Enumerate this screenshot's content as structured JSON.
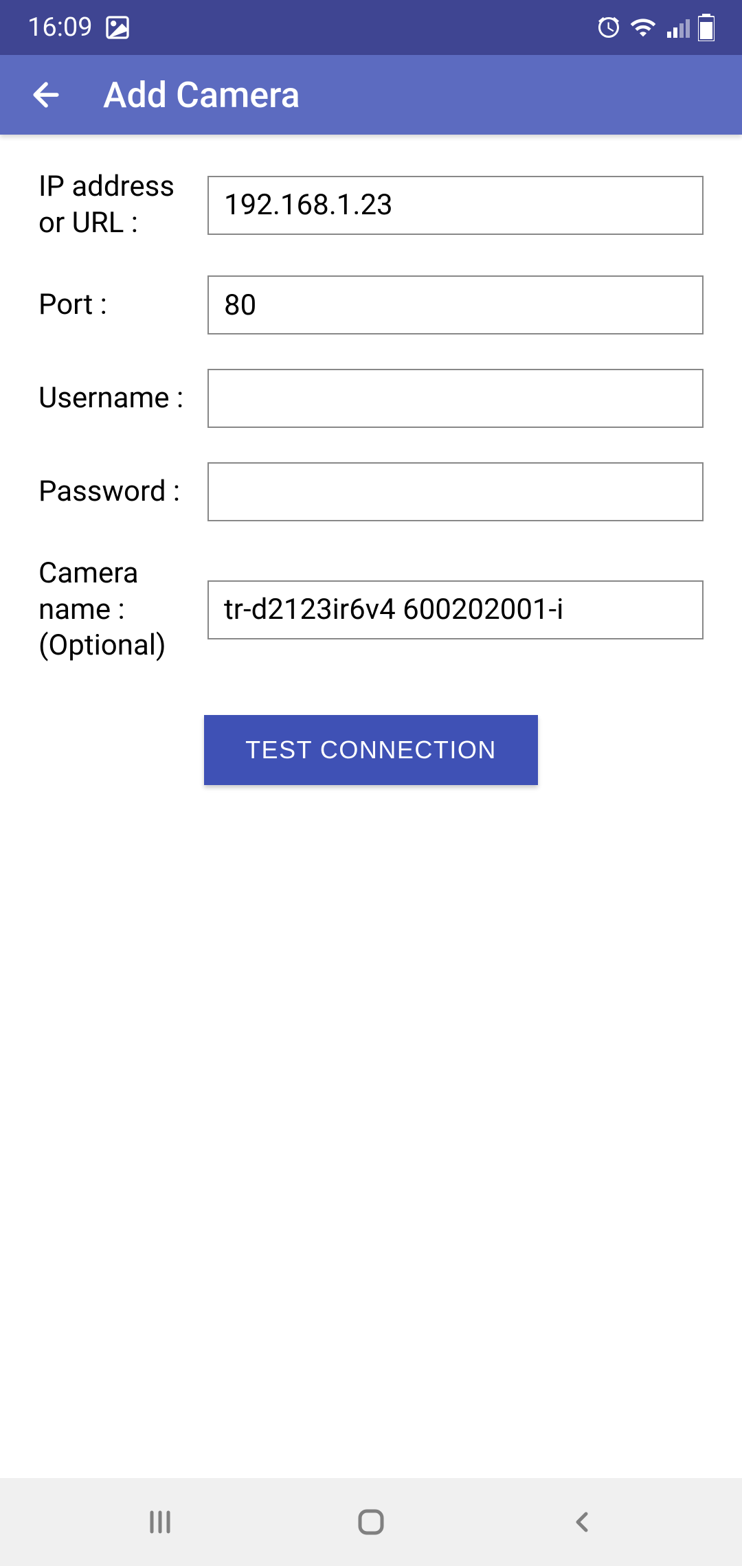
{
  "status_bar": {
    "time": "16:09"
  },
  "app_bar": {
    "title": "Add Camera"
  },
  "form": {
    "ip_label": "IP address or URL :",
    "ip_value": "192.168.1.23",
    "port_label": "Port :",
    "port_value": "80",
    "username_label": "Username :",
    "username_value": "",
    "password_label": "Password :",
    "password_value": "",
    "camera_name_label": "Camera name : (Optional)",
    "camera_name_value": "tr-d2123ir6v4 600202001-i"
  },
  "button": {
    "test_label": "TEST CONNECTION"
  },
  "colors": {
    "status_bg": "#3f4592",
    "appbar_bg": "#5c6bc0",
    "button_bg": "#3f51b5"
  }
}
